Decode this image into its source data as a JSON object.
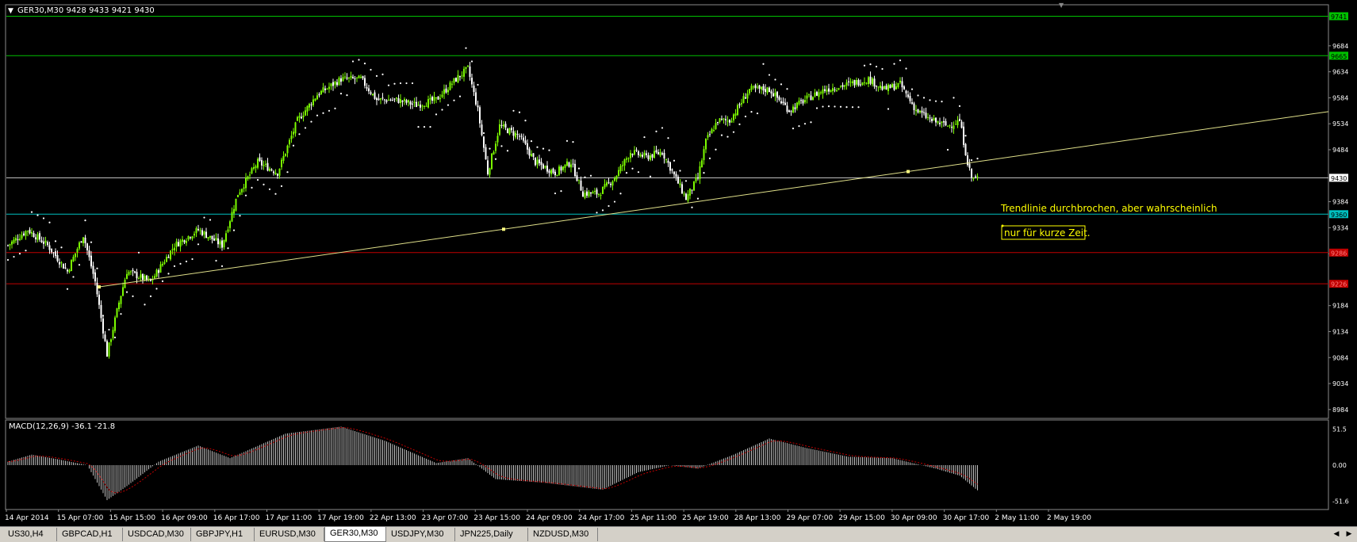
{
  "window": {
    "symbol_header": "GER30,M30  9428 9433 9421 9430",
    "indicator_header": "MACD(12,26,9) -36.1 -21.8"
  },
  "colors": {
    "background": "#000000",
    "candle_up": "#7cfc00",
    "candle_down": "#ffffff",
    "sar": "#ffffff",
    "trendline": "#e0e08a",
    "level_green": "#00c000",
    "level_white": "#c8c8c8",
    "level_cyan": "#00c0c0",
    "level_red": "#c00000",
    "macd_hist": "#c0c0c0",
    "macd_signal": "#c00000",
    "annotation": "#ffff00"
  },
  "price_axis": {
    "ticks": [
      "9684",
      "9634",
      "9584",
      "9534",
      "9484",
      "9384",
      "9334",
      "9284",
      "9184",
      "9134",
      "9084",
      "9034",
      "8984"
    ],
    "levels": [
      {
        "label": "9741",
        "price": 9741,
        "color": "#00c000",
        "tag_bg": "#00c000",
        "tag_fg": "#000000"
      },
      {
        "label": "9665",
        "price": 9665,
        "color": "#00c000",
        "tag_bg": "#00c000",
        "tag_fg": "#000000"
      },
      {
        "label": "9430",
        "price": 9430,
        "color": "#c8c8c8",
        "tag_bg": "#ffffff",
        "tag_fg": "#000000"
      },
      {
        "label": "9360",
        "price": 9360,
        "color": "#00c0c0",
        "tag_bg": "#00c0c0",
        "tag_fg": "#000000"
      },
      {
        "label": "9286",
        "price": 9286,
        "color": "#c00000",
        "tag_bg": "#c00000",
        "tag_fg": "#ff8080"
      },
      {
        "label": "9226",
        "price": 9226,
        "color": "#c00000",
        "tag_bg": "#c00000",
        "tag_fg": "#ff8080"
      }
    ]
  },
  "macd_axis": {
    "ticks": [
      "51.5",
      "0.00",
      "-51.6"
    ]
  },
  "time_axis": {
    "labels": [
      "14 Apr 2014",
      "15 Apr 07:00",
      "15 Apr 15:00",
      "16 Apr 09:00",
      "16 Apr 17:00",
      "17 Apr 11:00",
      "17 Apr 19:00",
      "22 Apr 13:00",
      "23 Apr 07:00",
      "23 Apr 15:00",
      "24 Apr 09:00",
      "24 Apr 17:00",
      "25 Apr 11:00",
      "25 Apr 19:00",
      "28 Apr 13:00",
      "29 Apr 07:00",
      "29 Apr 15:00",
      "30 Apr 09:00",
      "30 Apr 17:00",
      "2 May 11:00",
      "2 May 19:00"
    ]
  },
  "annotations": {
    "line1": "Trendlinie durchbrochen, aber wahrscheinlich",
    "line2": "nur für kurze Zeit."
  },
  "trendline": {
    "anchor_prices": [
      9220,
      9331,
      9442
    ]
  },
  "chart_data": {
    "type": "candlestick",
    "symbol": "GER30",
    "timeframe": "M30",
    "last_bar": {
      "open": 9428,
      "high": 9433,
      "low": 9421,
      "close": 9430
    },
    "ylim": [
      8970,
      9760
    ],
    "close_path": [
      {
        "i": 0,
        "c": 9300
      },
      {
        "i": 10,
        "c": 9330
      },
      {
        "i": 20,
        "c": 9300
      },
      {
        "i": 30,
        "c": 9250
      },
      {
        "i": 38,
        "c": 9320
      },
      {
        "i": 44,
        "c": 9230
      },
      {
        "i": 50,
        "c": 9090
      },
      {
        "i": 56,
        "c": 9190
      },
      {
        "i": 60,
        "c": 9250
      },
      {
        "i": 72,
        "c": 9230
      },
      {
        "i": 84,
        "c": 9300
      },
      {
        "i": 96,
        "c": 9330
      },
      {
        "i": 108,
        "c": 9300
      },
      {
        "i": 116,
        "c": 9400
      },
      {
        "i": 126,
        "c": 9460
      },
      {
        "i": 136,
        "c": 9440
      },
      {
        "i": 146,
        "c": 9540
      },
      {
        "i": 156,
        "c": 9590
      },
      {
        "i": 168,
        "c": 9620
      },
      {
        "i": 178,
        "c": 9620
      },
      {
        "i": 186,
        "c": 9580
      },
      {
        "i": 196,
        "c": 9580
      },
      {
        "i": 206,
        "c": 9570
      },
      {
        "i": 216,
        "c": 9580
      },
      {
        "i": 226,
        "c": 9620
      },
      {
        "i": 232,
        "c": 9640
      },
      {
        "i": 237,
        "c": 9560
      },
      {
        "i": 242,
        "c": 9440
      },
      {
        "i": 248,
        "c": 9530
      },
      {
        "i": 258,
        "c": 9510
      },
      {
        "i": 266,
        "c": 9460
      },
      {
        "i": 276,
        "c": 9440
      },
      {
        "i": 284,
        "c": 9460
      },
      {
        "i": 290,
        "c": 9400
      },
      {
        "i": 298,
        "c": 9400
      },
      {
        "i": 306,
        "c": 9430
      },
      {
        "i": 314,
        "c": 9480
      },
      {
        "i": 322,
        "c": 9470
      },
      {
        "i": 330,
        "c": 9480
      },
      {
        "i": 338,
        "c": 9420
      },
      {
        "i": 342,
        "c": 9390
      },
      {
        "i": 348,
        "c": 9430
      },
      {
        "i": 352,
        "c": 9500
      },
      {
        "i": 358,
        "c": 9540
      },
      {
        "i": 364,
        "c": 9540
      },
      {
        "i": 374,
        "c": 9600
      },
      {
        "i": 384,
        "c": 9600
      },
      {
        "i": 394,
        "c": 9560
      },
      {
        "i": 402,
        "c": 9580
      },
      {
        "i": 412,
        "c": 9600
      },
      {
        "i": 424,
        "c": 9610
      },
      {
        "i": 434,
        "c": 9620
      },
      {
        "i": 442,
        "c": 9600
      },
      {
        "i": 450,
        "c": 9610
      },
      {
        "i": 458,
        "c": 9560
      },
      {
        "i": 466,
        "c": 9540
      },
      {
        "i": 474,
        "c": 9530
      },
      {
        "i": 480,
        "c": 9540
      },
      {
        "i": 484,
        "c": 9460
      },
      {
        "i": 486,
        "c": 9430
      },
      {
        "i": 489,
        "c": 9430
      }
    ],
    "macd_ylim": [
      -60,
      60
    ],
    "macd_path": [
      {
        "i": 0,
        "h": 5
      },
      {
        "i": 12,
        "h": 15
      },
      {
        "i": 26,
        "h": 8
      },
      {
        "i": 40,
        "h": 0
      },
      {
        "i": 50,
        "h": -50
      },
      {
        "i": 60,
        "h": -30
      },
      {
        "i": 76,
        "h": 5
      },
      {
        "i": 96,
        "h": 28
      },
      {
        "i": 112,
        "h": 10
      },
      {
        "i": 140,
        "h": 45
      },
      {
        "i": 168,
        "h": 55
      },
      {
        "i": 190,
        "h": 35
      },
      {
        "i": 216,
        "h": 3
      },
      {
        "i": 232,
        "h": 10
      },
      {
        "i": 246,
        "h": -20
      },
      {
        "i": 270,
        "h": -25
      },
      {
        "i": 300,
        "h": -35
      },
      {
        "i": 318,
        "h": -10
      },
      {
        "i": 334,
        "h": 0
      },
      {
        "i": 348,
        "h": -5
      },
      {
        "i": 366,
        "h": 15
      },
      {
        "i": 384,
        "h": 38
      },
      {
        "i": 402,
        "h": 25
      },
      {
        "i": 424,
        "h": 12
      },
      {
        "i": 446,
        "h": 10
      },
      {
        "i": 468,
        "h": -5
      },
      {
        "i": 480,
        "h": -15
      },
      {
        "i": 489,
        "h": -36
      }
    ]
  },
  "tabs": [
    {
      "label": "US30,H4",
      "active": false
    },
    {
      "label": "GBPCAD,H1",
      "active": false
    },
    {
      "label": "USDCAD,M30",
      "active": false
    },
    {
      "label": "GBPJPY,H1",
      "active": false
    },
    {
      "label": "EURUSD,M30",
      "active": false
    },
    {
      "label": "GER30,M30",
      "active": true
    },
    {
      "label": "USDJPY,M30",
      "active": false
    },
    {
      "label": "JPN225,Daily",
      "active": false
    },
    {
      "label": "NZDUSD,M30",
      "active": false
    }
  ]
}
